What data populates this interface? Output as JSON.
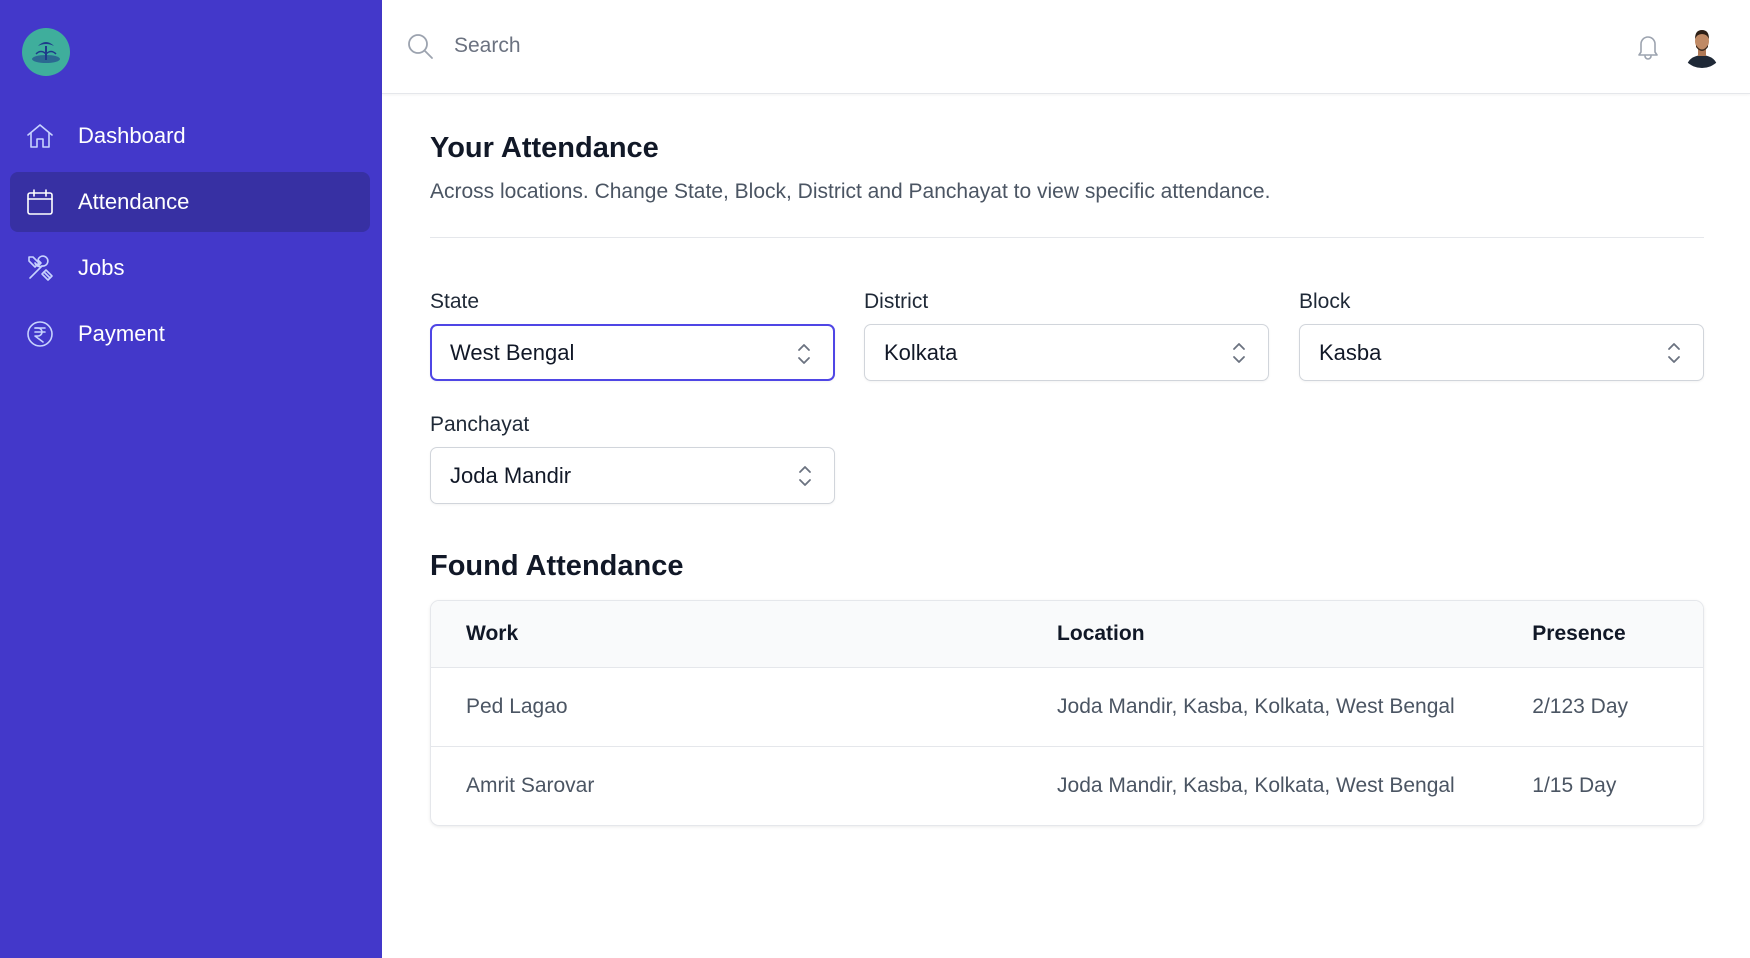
{
  "sidebar": {
    "items": [
      {
        "label": "Dashboard",
        "icon": "home-icon"
      },
      {
        "label": "Attendance",
        "icon": "calendar-icon",
        "active": true
      },
      {
        "label": "Jobs",
        "icon": "tools-icon"
      },
      {
        "label": "Payment",
        "icon": "rupee-icon"
      }
    ]
  },
  "header": {
    "search_placeholder": "Search"
  },
  "page": {
    "title": "Your Attendance",
    "subtitle": "Across locations. Change State, Block, District and Panchayat to view specific attendance."
  },
  "filters": {
    "state": {
      "label": "State",
      "value": "West Bengal"
    },
    "district": {
      "label": "District",
      "value": "Kolkata"
    },
    "block": {
      "label": "Block",
      "value": "Kasba"
    },
    "panchayat": {
      "label": "Panchayat",
      "value": "Joda Mandir"
    }
  },
  "results": {
    "title": "Found Attendance",
    "columns": [
      "Work",
      "Location",
      "Presence"
    ],
    "rows": [
      [
        "Ped Lagao",
        "Joda Mandir, Kasba, Kolkata, West Bengal",
        "2/123 Day"
      ],
      [
        "Amrit Sarovar",
        "Joda Mandir, Kasba, Kolkata, West Bengal",
        "1/15 Day"
      ]
    ]
  },
  "colors": {
    "sidebar": "#4338ca",
    "sidebar_active": "#3730a3",
    "focus_ring": "#4f46e5",
    "logo_bg": "#3fae9c"
  }
}
